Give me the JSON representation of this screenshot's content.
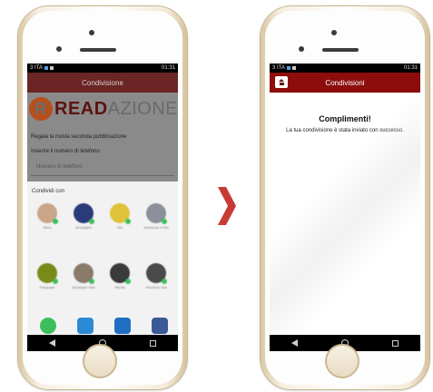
{
  "colors": {
    "brand_red": "#8d0d0d",
    "arrow": "#c83a34",
    "whatsapp_green": "#3cbf5b"
  },
  "left_phone": {
    "status_carrier": "3 ITA",
    "status_time": "01:31",
    "title": "Condivisione",
    "logo_part1": "READ",
    "logo_part2": "AZIONE",
    "line1": "Regala la rivista seconda pubblicazione",
    "line2": "Inserire il numero di telefono",
    "input_placeholder": "Numero di telefono",
    "share_title": "Condividi con",
    "contacts": [
      {
        "name": "Moro"
      },
      {
        "name": "Arcangelo"
      },
      {
        "name": "Gio"
      },
      {
        "name": "Annuccia e Fiol"
      },
      {
        "name": "Pasquale"
      },
      {
        "name": "Giuseppe Gen"
      },
      {
        "name": "Nicola"
      },
      {
        "name": "Vincenzo Sal"
      }
    ]
  },
  "right_phone": {
    "status_carrier": "3 ITA",
    "status_time": "01:31",
    "title": "Condivisioni",
    "heading": "Complimenti!",
    "message": "La tua condivisione è stata inviato con successo."
  },
  "icons": {
    "home": "home-icon",
    "arrow": "chevron-right-icon",
    "back": "nav-back-icon",
    "nav_home": "nav-home-icon",
    "recent": "nav-recent-icon"
  }
}
